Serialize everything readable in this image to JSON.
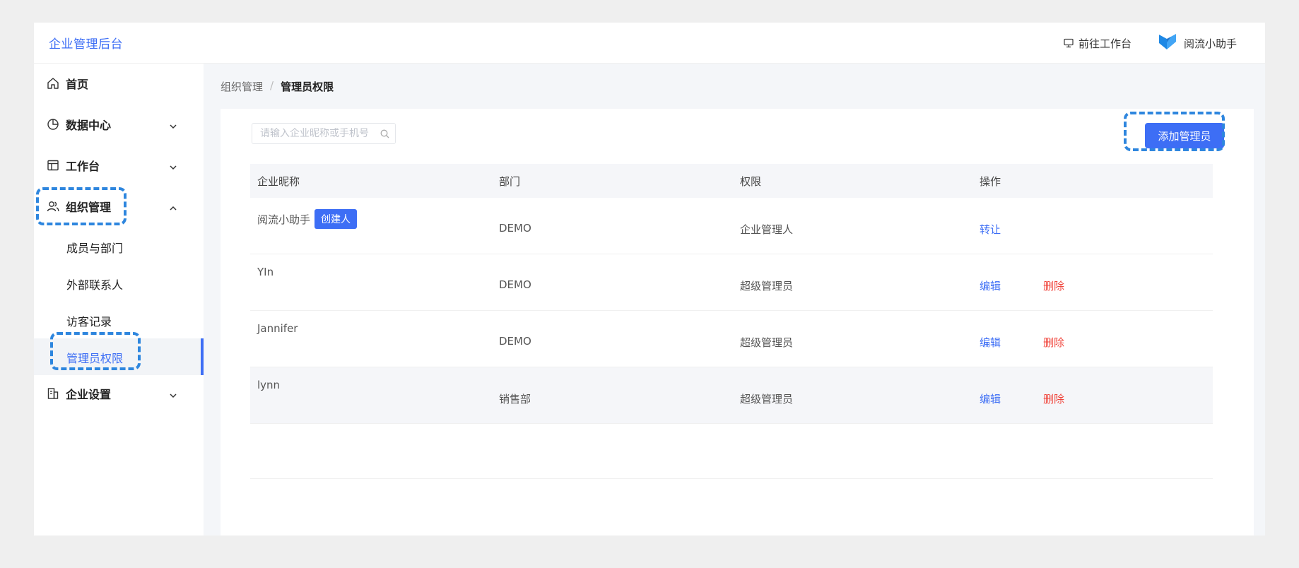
{
  "header": {
    "brand": "企业管理后台",
    "workbench_link": "前往工作台",
    "assistant_name": "阅流小助手"
  },
  "sidebar": {
    "items": [
      {
        "label": "首页",
        "icon": "home-icon"
      },
      {
        "label": "数据中心",
        "icon": "pie-chart-icon"
      },
      {
        "label": "工作台",
        "icon": "layout-icon"
      },
      {
        "label": "组织管理",
        "icon": "users-icon"
      },
      {
        "label": "企业设置",
        "icon": "building-icon"
      }
    ],
    "sub_items": [
      {
        "label": "成员与部门"
      },
      {
        "label": "外部联系人"
      },
      {
        "label": "访客记录"
      },
      {
        "label": "管理员权限"
      }
    ]
  },
  "breadcrumb": {
    "parent": "组织管理",
    "separator": "/",
    "current": "管理员权限"
  },
  "search": {
    "placeholder": "请输入企业昵称或手机号"
  },
  "toolbar": {
    "add_admin_label": "添加管理员"
  },
  "table": {
    "columns": [
      "企业昵称",
      "部门",
      "权限",
      "操作"
    ],
    "creator_tag": "创建人",
    "rows": [
      {
        "name": "阅流小助手",
        "dept": "DEMO",
        "permission": "企业管理人",
        "action1": "转让",
        "action2": ""
      },
      {
        "name": "YIn",
        "dept": "DEMO",
        "permission": "超级管理员",
        "action1": "编辑",
        "action2": "删除"
      },
      {
        "name": "Jannifer",
        "dept": "DEMO",
        "permission": "超级管理员",
        "action1": "编辑",
        "action2": "删除"
      },
      {
        "name": "lynn",
        "dept": "销售部",
        "permission": "超级管理员",
        "action1": "编辑",
        "action2": "删除"
      }
    ]
  },
  "colors": {
    "accent": "#3d6ef5",
    "danger": "#f0443b",
    "highlight": "#2e86de"
  }
}
